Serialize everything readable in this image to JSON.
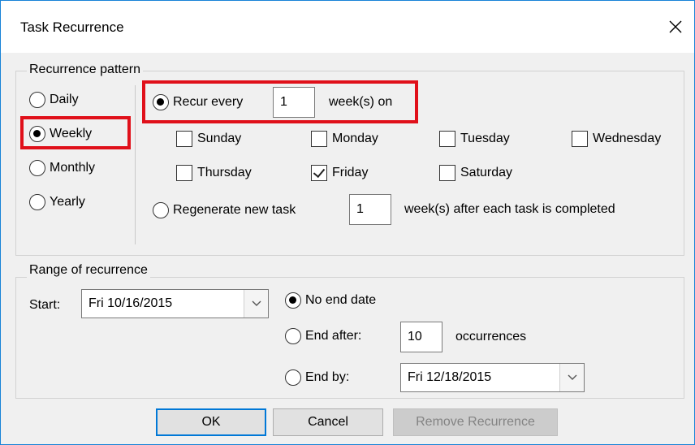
{
  "window": {
    "title": "Task Recurrence",
    "close_icon": "close-icon"
  },
  "pattern": {
    "group_label": "Recurrence pattern",
    "frequencies": [
      {
        "label": "Daily",
        "selected": false
      },
      {
        "label": "Weekly",
        "selected": true
      },
      {
        "label": "Monthly",
        "selected": false
      },
      {
        "label": "Yearly",
        "selected": false
      }
    ],
    "recur_every": {
      "label": "Recur every",
      "selected": true,
      "value": "1",
      "suffix": "week(s) on"
    },
    "days": [
      {
        "label": "Sunday",
        "checked": false
      },
      {
        "label": "Monday",
        "checked": false
      },
      {
        "label": "Tuesday",
        "checked": false
      },
      {
        "label": "Wednesday",
        "checked": false
      },
      {
        "label": "Thursday",
        "checked": false
      },
      {
        "label": "Friday",
        "checked": true
      },
      {
        "label": "Saturday",
        "checked": false
      }
    ],
    "regenerate": {
      "label": "Regenerate new task",
      "selected": false,
      "value": "1",
      "suffix": "week(s) after each task is completed"
    }
  },
  "range": {
    "group_label": "Range of recurrence",
    "start_label": "Start:",
    "start_value": "Fri 10/16/2015",
    "no_end": {
      "label": "No end date",
      "selected": true
    },
    "end_after": {
      "label": "End after:",
      "selected": false,
      "value": "10",
      "suffix": "occurrences"
    },
    "end_by": {
      "label": "End by:",
      "selected": false,
      "value": "Fri 12/18/2015"
    }
  },
  "buttons": {
    "ok": "OK",
    "cancel": "Cancel",
    "remove": "Remove Recurrence"
  },
  "colors": {
    "highlight": "#e0101a",
    "accent": "#0078d7"
  }
}
